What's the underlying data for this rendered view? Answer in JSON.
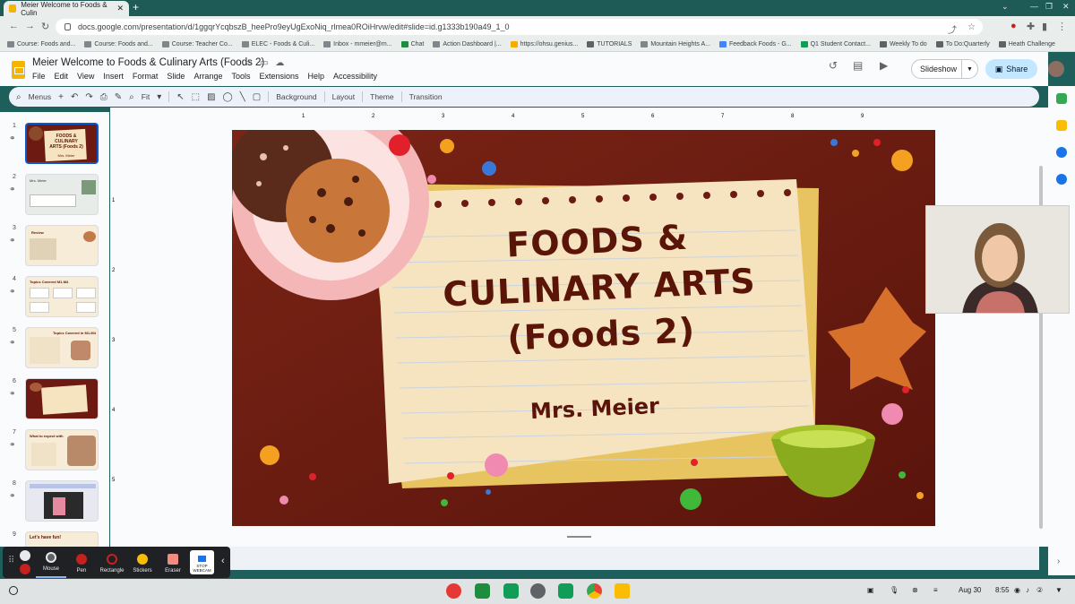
{
  "browser": {
    "tab_title": "Meier Welcome to Foods & Culin",
    "url": "docs.google.com/presentation/d/1ggqrYcqbszB_heePro9eyUgExoNiq_rlmea0ROiHrvw/edit#slide=id.g1333b190a49_1_0",
    "bookmarks": [
      "Course: Foods and...",
      "Course: Foods and...",
      "Course: Teacher Co...",
      "ELEC - Foods & Culi...",
      "Inbox - mmeier@m...",
      "Chat",
      "Action Dashboard |...",
      "https://ohsu.genius...",
      "TUTORIALS",
      "Mountain Heights A...",
      "Feedback Foods - G...",
      "Q1 Student Contact...",
      "Weekly To do",
      "To Do:Quarterly",
      "Heath Challenge"
    ]
  },
  "docs": {
    "title": "Meier Welcome to Foods & Culinary Arts (Foods 2)",
    "menu": [
      "File",
      "Edit",
      "View",
      "Insert",
      "Format",
      "Slide",
      "Arrange",
      "Tools",
      "Extensions",
      "Help",
      "Accessibility"
    ],
    "slideshow_label": "Slideshow",
    "share_label": "Share"
  },
  "toolbar": {
    "menus_label": "Menus",
    "zoom_label": "Fit",
    "background_label": "Background",
    "layout_label": "Layout",
    "theme_label": "Theme",
    "transition_label": "Transition"
  },
  "ruler_ticks": [
    "1",
    "2",
    "3",
    "4",
    "5",
    "6",
    "7",
    "8",
    "9"
  ],
  "ruler_v_ticks": [
    "1",
    "2",
    "3",
    "4",
    "5"
  ],
  "filmstrip": {
    "numbers": [
      "1",
      "2",
      "3",
      "4",
      "5",
      "6",
      "7",
      "8",
      "9"
    ],
    "thumbs": [
      {
        "text": "FOODS & CULINARY ARTS (Foods 2)",
        "sub": "Mrs. Meier"
      },
      {
        "text": "Mrs. Meier",
        "sub": ""
      },
      {
        "text": "Review",
        "sub": ""
      },
      {
        "text": "Topics Covered M1-M4",
        "sub": ""
      },
      {
        "text": "Topics Covered in M1-M4",
        "sub": ""
      },
      {
        "text": "",
        "sub": ""
      },
      {
        "text": "What to expect with",
        "sub": ""
      },
      {
        "text": "",
        "sub": ""
      },
      {
        "text": "Let's have fun!",
        "sub": ""
      }
    ]
  },
  "slide": {
    "line1": "FOODS &",
    "line2": "CULINARY ARTS",
    "line3": "(Foods 2)",
    "author": "Mrs. Meier"
  },
  "screencast": {
    "mouse_label": "Mouse",
    "pen_label": "Pen",
    "rectangle_label": "Rectangle",
    "stickers_label": "Stickers",
    "eraser_label": "Eraser",
    "stop_webcam_label": "STOP WEBCAM"
  },
  "shelf": {
    "date": "Aug 30",
    "time": "8:55"
  },
  "colors": {
    "slide_bg": "#6d1a12",
    "paper": "#f6e4c0",
    "title_text": "#5a1408",
    "share_bg": "#c2e7ff"
  }
}
